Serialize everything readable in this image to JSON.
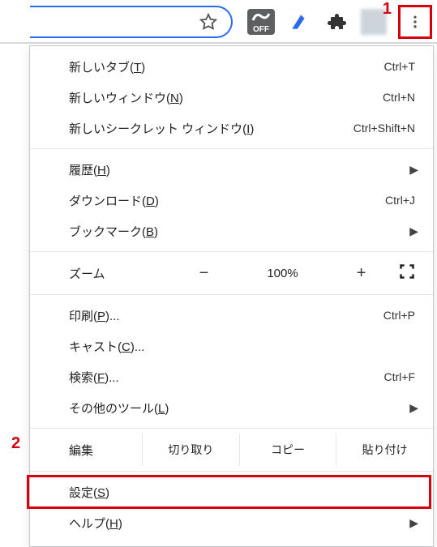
{
  "callouts": {
    "one": "1",
    "two": "2"
  },
  "extension_off_label": "OFF",
  "menu": {
    "new_tab": {
      "label_pre": "新しいタブ(",
      "mnemonic": "T",
      "label_post": ")",
      "shortcut": "Ctrl+T"
    },
    "new_window": {
      "label_pre": "新しいウィンドウ(",
      "mnemonic": "N",
      "label_post": ")",
      "shortcut": "Ctrl+N"
    },
    "incognito": {
      "label_pre": "新しいシークレット ウィンドウ(",
      "mnemonic": "I",
      "label_post": ")",
      "shortcut": "Ctrl+Shift+N"
    },
    "history": {
      "label_pre": "履歴(",
      "mnemonic": "H",
      "label_post": ")"
    },
    "downloads": {
      "label_pre": "ダウンロード(",
      "mnemonic": "D",
      "label_post": ")",
      "shortcut": "Ctrl+J"
    },
    "bookmarks": {
      "label_pre": "ブックマーク(",
      "mnemonic": "B",
      "label_post": ")"
    },
    "zoom": {
      "label": "ズーム",
      "pct": "100%",
      "minus": "−",
      "plus": "+"
    },
    "print": {
      "label_pre": "印刷(",
      "mnemonic": "P",
      "label_post": ")...",
      "shortcut": "Ctrl+P"
    },
    "cast": {
      "label_pre": "キャスト(",
      "mnemonic": "C",
      "label_post": ")..."
    },
    "find": {
      "label_pre": "検索(",
      "mnemonic": "F",
      "label_post": ")...",
      "shortcut": "Ctrl+F"
    },
    "more_tools": {
      "label_pre": "その他のツール(",
      "mnemonic": "L",
      "label_post": ")"
    },
    "edit": {
      "label": "編集",
      "cut": "切り取り",
      "copy": "コピー",
      "paste": "貼り付け"
    },
    "settings": {
      "label_pre": "設定(",
      "mnemonic": "S",
      "label_post": ")"
    },
    "help": {
      "label_pre": "ヘルプ(",
      "mnemonic": "H",
      "label_post": ")"
    }
  }
}
